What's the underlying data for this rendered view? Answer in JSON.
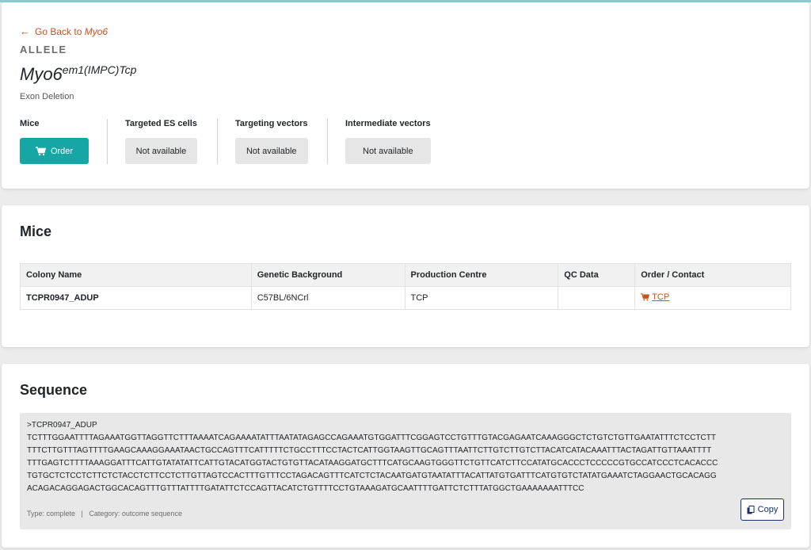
{
  "header": {
    "back_prefix": "Go Back to ",
    "back_gene": "Myo6",
    "section_label": "ALLELE",
    "allele_base": "Myo6",
    "allele_sup": "em1(IMPC)",
    "allele_suffix": "Tcp",
    "allele_type": "Exon Deletion"
  },
  "products": {
    "mice_title": "Mice",
    "mice_button": "Order",
    "es_title": "Targeted ES cells",
    "es_status": "Not available",
    "tv_title": "Targeting vectors",
    "tv_status": "Not available",
    "iv_title": "Intermediate vectors",
    "iv_status": "Not available"
  },
  "mice": {
    "title": "Mice",
    "columns": [
      "Colony Name",
      "Genetic Background",
      "Production Centre",
      "QC Data",
      "Order / Contact"
    ],
    "rows": [
      {
        "colony": "TCPR0947_ADUP",
        "background": "C57BL/6NCrl",
        "centre": "TCP",
        "qc": "",
        "order": "TCP"
      }
    ]
  },
  "sequence": {
    "title": "Sequence",
    "header": ">TCPR0947_ADUP",
    "lines": [
      "TCTTTGGAATTTTAGAAATGGTTAGGTTCTTTAAAATCAGAAAATATTTAATATAGAGCCAGAAATGTGGATTTCGGAGTCCTGTTTGTACGAGAATCAAAGGGCTCTGTCTGTTGAATATTTCTCCTCTT",
      "TTTCTTGTTTAGTTTTGAAGCAAAGGAAATAACTGCCAGTTTCATTTTTCTGCCTTTCCTACTCATTGGTAAGTTGCAGTTTAATTCTTGTCTTGTCTTACATCATACAAATTTACTAGATTGTTAAATTTT",
      "TTTGAGTCTTTTAAAGGATTTCATTGTATATATTCATTGTACATGGTACTGTGTTACATAAGGATGCTTTCATGCAAGTGGGTTCTGTTCATCTTCCATATGCACCCTCCCCCGTGCCATCCCTCACACCC",
      "TGTGCTCTCCTCTTCTCTACCTCTTCCTCTTGTTAGTCCACTTTGTTTCCTAGACAGTTTCATCTCTACAATGATGTAATATTTACATTATGTGATTTCATGTGTCTATATGAAATCTAGGAACTGCACAGG",
      "ACAGACAGGAGACTGGCACAGTTTGTTTATTTTGATATTCTCCAGTTACATCTGTTTTCCTGTAAAGATGCAATTTTGATTCTCTTTATGGCTGAAAAAAATTTCC"
    ],
    "meta": "Type: complete   |   Category: outcome sequence",
    "copy_label": "Copy"
  },
  "icons": {
    "back": "arrow-left-icon",
    "cart": "cart-icon",
    "copy": "copy-icon"
  },
  "colors": {
    "accent": "#16a6a6",
    "link": "#c8511a",
    "copy_border": "#1a2f6d"
  }
}
